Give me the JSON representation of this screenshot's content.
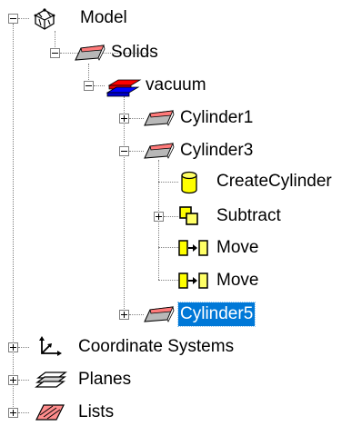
{
  "tree": {
    "model": {
      "label": "Model",
      "icon": "model-icon",
      "expanded": true
    },
    "solids": {
      "label": "Solids",
      "icon": "solid-icon",
      "expanded": true
    },
    "vacuum": {
      "label": "vacuum",
      "icon": "material-stack-icon",
      "expanded": true
    },
    "cylinder1": {
      "label": "Cylinder1",
      "icon": "solid-icon",
      "expanded": false
    },
    "cylinder3": {
      "label": "Cylinder3",
      "icon": "solid-icon",
      "expanded": true
    },
    "create_cylinder": {
      "label": "CreateCylinder",
      "icon": "cylinder-icon"
    },
    "subtract": {
      "label": "Subtract",
      "icon": "subtract-icon",
      "expanded": false
    },
    "move1": {
      "label": "Move",
      "icon": "move-icon"
    },
    "move2": {
      "label": "Move",
      "icon": "move-icon"
    },
    "cylinder5": {
      "label": "Cylinder5",
      "icon": "solid-icon",
      "expanded": false,
      "selected": true
    },
    "coordinate_systems": {
      "label": "Coordinate Systems",
      "icon": "axes-icon",
      "expanded": false
    },
    "planes": {
      "label": "Planes",
      "icon": "planes-icon",
      "expanded": false
    },
    "lists": {
      "label": "Lists",
      "icon": "lists-icon",
      "expanded": false
    }
  },
  "colors": {
    "selection": "#0078d7",
    "connector": "#808080",
    "cylinder_yellow": "#ffff00",
    "vacuum_red": "#ff0000",
    "vacuum_blue": "#0000ff"
  }
}
